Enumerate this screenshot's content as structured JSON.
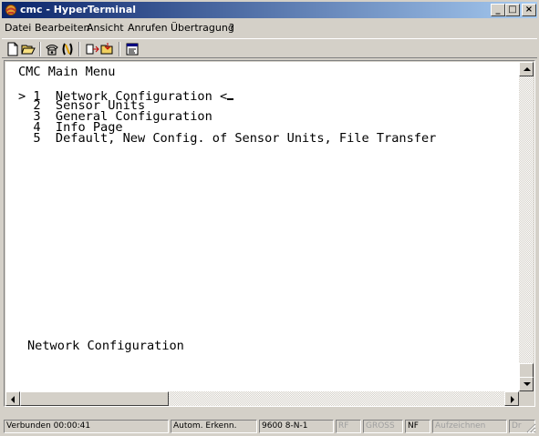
{
  "window": {
    "title": "cmc - HyperTerminal",
    "controls": {
      "minimize": "_",
      "maximize": "□",
      "close": "×"
    }
  },
  "menubar": {
    "items": [
      "Datei",
      "Bearbeiten",
      "Ansicht",
      "Anrufen",
      "Übertragung",
      "?"
    ]
  },
  "toolbar": {
    "buttons": [
      "new-document-icon",
      "open-folder-icon",
      "connect-phone-icon",
      "disconnect-phone-icon",
      "send-icon",
      "receive-icon",
      "properties-icon"
    ]
  },
  "terminal": {
    "lines": [
      "CMC Main Menu",
      "",
      "> 1  Network Configuration <",
      "  2  Sensor Units",
      "  3  General Configuration",
      "  4  Info Page",
      "  5  Default, New Config. of Sensor Units, File Transfer"
    ],
    "footer": "Network Configuration"
  },
  "statusbar": {
    "connected": "Verbunden 00:00:41",
    "detect": "Autom. Erkenn.",
    "port_settings": "9600 8-N-1",
    "rf": "RF",
    "caps": "GROSS",
    "num": "NF",
    "capture": "Aufzeichnen",
    "print": "Dr"
  },
  "colors": {
    "titlebar_start": "#0a246a",
    "titlebar_end": "#a6caf0",
    "face": "#d4d0c8",
    "terminal_bg": "#ffffff"
  }
}
